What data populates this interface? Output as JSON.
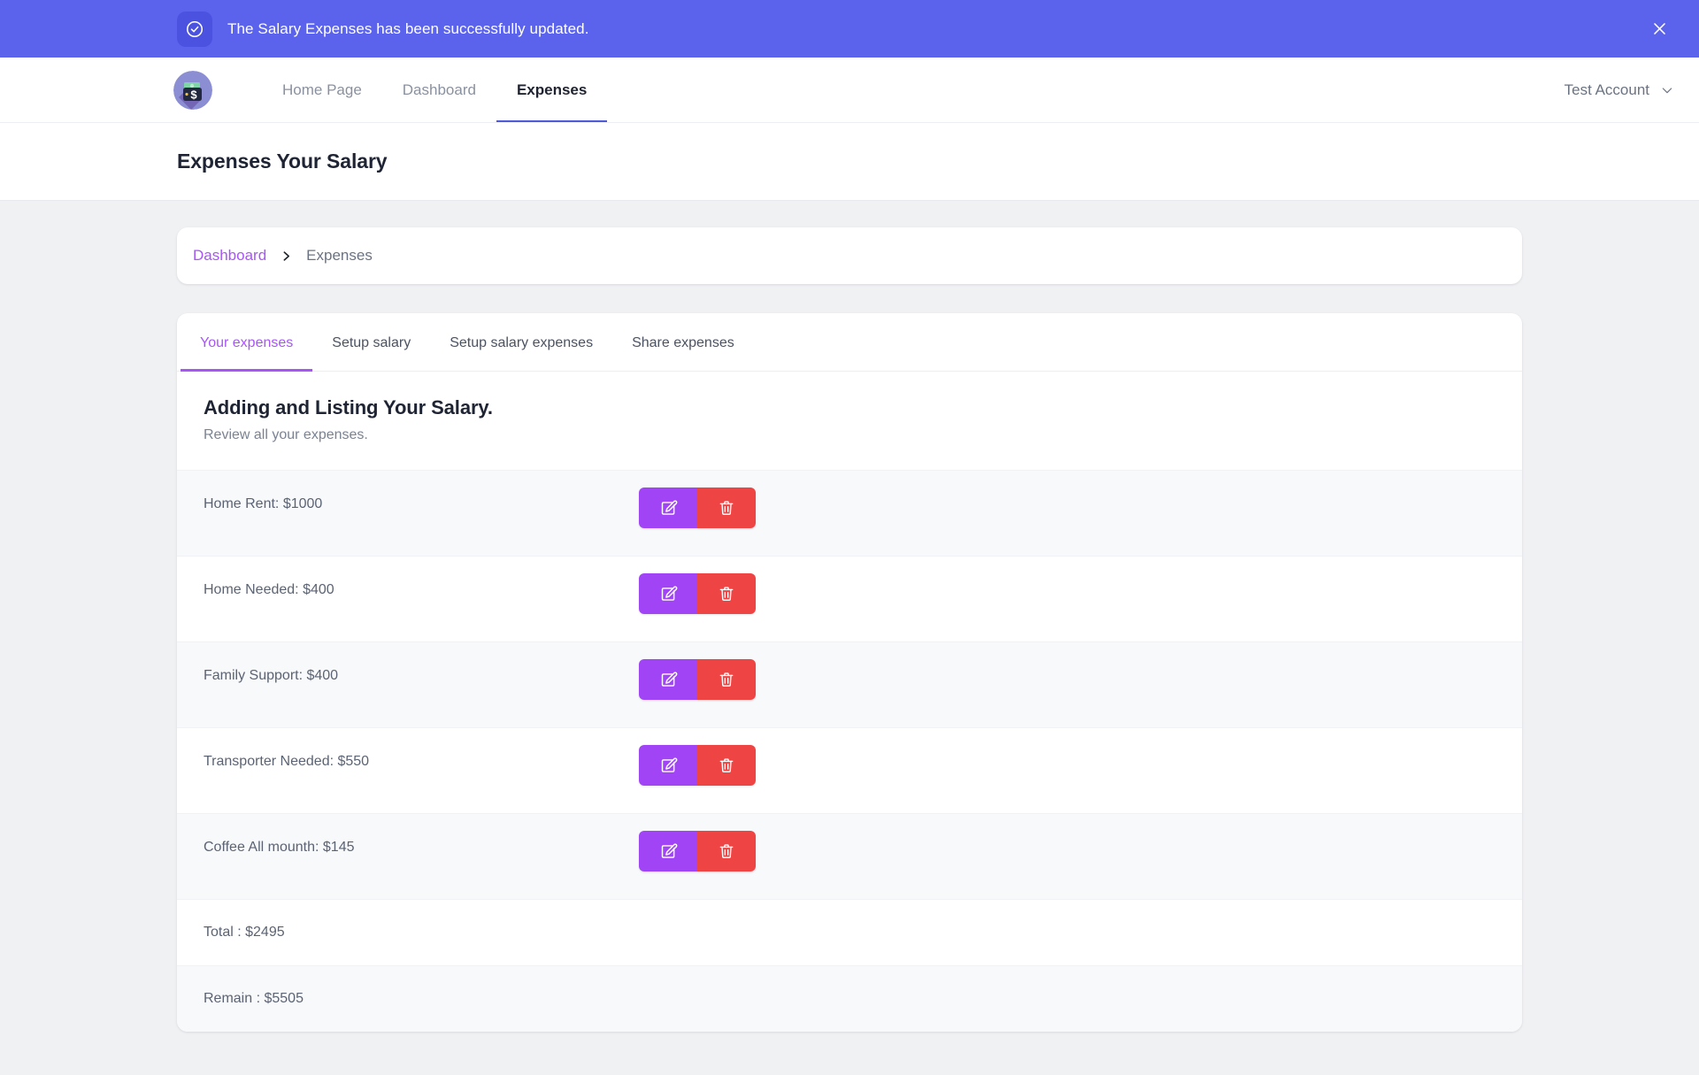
{
  "alert": {
    "message": "The Salary Expenses has been successfully updated.",
    "icon": "check-circle-icon",
    "close_icon": "close-icon",
    "background_color": "#5b63ec"
  },
  "navbar": {
    "brand_icon": "money-wallet-logo-icon",
    "links": [
      {
        "label": "Home Page",
        "active": false
      },
      {
        "label": "Dashboard",
        "active": false
      },
      {
        "label": "Expenses",
        "active": true
      }
    ],
    "account": {
      "label": "Test Account",
      "chevron_icon": "chevron-down-icon"
    }
  },
  "page": {
    "title": "Expenses Your Salary"
  },
  "breadcrumb": {
    "link_label": "Dashboard",
    "separator_icon": "chevron-right-icon",
    "current_label": "Expenses",
    "link_color": "#a855f7"
  },
  "tabs": [
    {
      "label": "Your expenses",
      "active": true
    },
    {
      "label": "Setup salary",
      "active": false
    },
    {
      "label": "Setup salary expenses",
      "active": false
    },
    {
      "label": "Share expenses",
      "active": false
    }
  ],
  "section": {
    "title": "Adding and Listing Your Salary.",
    "subtitle": "Review all your expenses."
  },
  "expenses": [
    {
      "label": "Home Rent: $1000",
      "edit_icon": "edit-pencil-icon",
      "delete_icon": "trash-icon"
    },
    {
      "label": "Home Needed: $400",
      "edit_icon": "edit-pencil-icon",
      "delete_icon": "trash-icon"
    },
    {
      "label": "Family Support: $400",
      "edit_icon": "edit-pencil-icon",
      "delete_icon": "trash-icon"
    },
    {
      "label": "Transporter Needed: $550",
      "edit_icon": "edit-pencil-icon",
      "delete_icon": "trash-icon"
    },
    {
      "label": "Coffee All mounth: $145",
      "edit_icon": "edit-pencil-icon",
      "delete_icon": "trash-icon"
    }
  ],
  "summary": [
    {
      "label": "Total : $2495"
    },
    {
      "label": "Remain : $5505"
    }
  ],
  "colors": {
    "accent_purple": "#a855f7",
    "banner_indigo": "#5b63ec",
    "edit_button": "#a044f5",
    "delete_button": "#ef4444",
    "page_background": "#f0f1f3"
  }
}
